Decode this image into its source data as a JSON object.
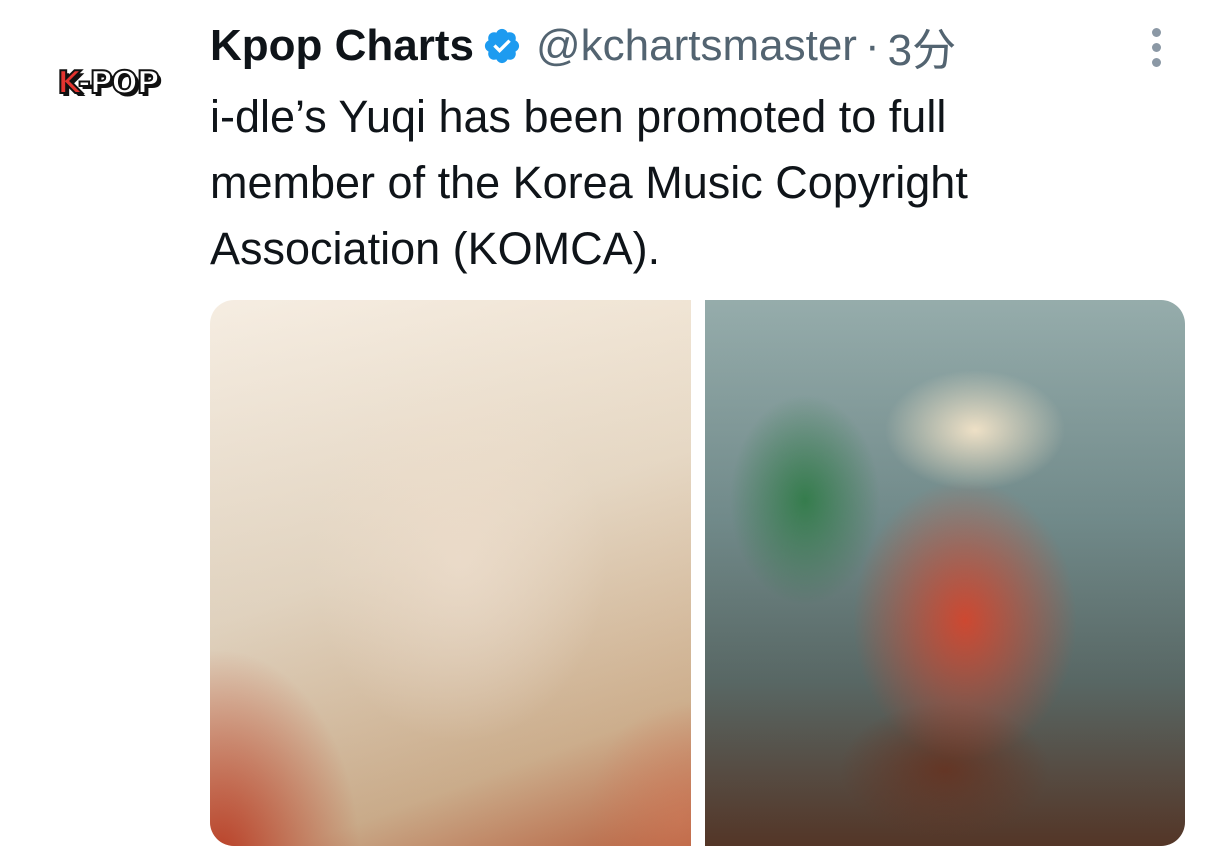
{
  "avatar": {
    "logo_k": "K",
    "logo_rest": "-POP"
  },
  "tweet": {
    "display_name": "Kpop Charts",
    "handle": "@kchartsmaster",
    "separator": "·",
    "time": "3分",
    "text": "i-dle’s Yuqi has been promoted to full member of the Korea Music Copyright Association (KOMCA)."
  },
  "icons": {
    "verified": "verified-badge-icon",
    "more": "more-options-icon"
  },
  "colors": {
    "verified_blue": "#1d9bf0",
    "secondary_text": "#536471",
    "primary_text": "#0f1419"
  },
  "media": {
    "count": 2
  }
}
